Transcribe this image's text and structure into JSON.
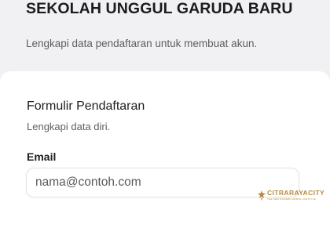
{
  "header": {
    "school_name": "SEKOLAH UNGGUL GARUDA BARU",
    "subtitle": "Lengkapi data pendaftaran untuk membuat akun."
  },
  "form": {
    "title": "Formulir Pendaftaran",
    "subtitle": "Lengkapi data diri.",
    "email": {
      "label": "Email",
      "value": "",
      "placeholder": "nama@contoh.com"
    }
  },
  "watermark": {
    "name": "CITRARAYACITY",
    "tagline": "THE NEW MODERN URBAN LIFESTYLE",
    "logo_icon": "citraraya-logo-icon",
    "color": "#b88a3e"
  },
  "colors": {
    "page_background": "#f1f1f3",
    "card_background": "#ffffff",
    "input_border": "#e3e3e6"
  }
}
